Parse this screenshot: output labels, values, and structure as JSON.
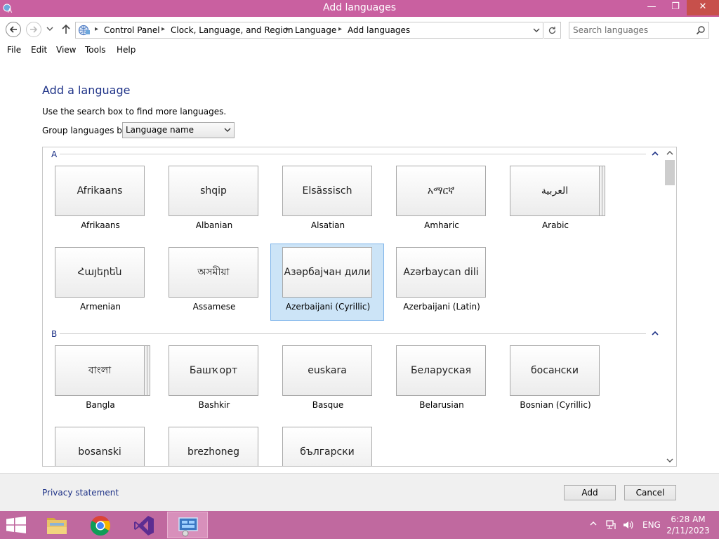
{
  "window": {
    "title": "Add languages",
    "min_label": "—",
    "max_label": "❐",
    "close_label": "✕"
  },
  "address": {
    "breadcrumbs": [
      "Control Panel",
      "Clock, Language, and Region",
      "Language",
      "Add languages"
    ],
    "search_placeholder": "Search languages"
  },
  "menu": [
    "File",
    "Edit",
    "View",
    "Tools",
    "Help"
  ],
  "main": {
    "title": "Add a language",
    "hint": "Use the search box to find more languages.",
    "group_by_label": "Group languages by:",
    "group_by_value": "Language name"
  },
  "groups": [
    {
      "letter": "A",
      "languages": [
        {
          "native": "Afrikaans",
          "name": "Afrikaans"
        },
        {
          "native": "shqip",
          "name": "Albanian"
        },
        {
          "native": "Elsässisch",
          "name": "Alsatian"
        },
        {
          "native": "አማርኛ",
          "name": "Amharic"
        },
        {
          "native": "العربية",
          "name": "Arabic"
        },
        {
          "native": "Հայերեն",
          "name": "Armenian"
        },
        {
          "native": "অসমীয়া",
          "name": "Assamese"
        },
        {
          "native": "Азәрбајҹан дили",
          "name": "Azerbaijani (Cyrillic)"
        },
        {
          "native": "Azərbaycan dili",
          "name": "Azerbaijani (Latin)"
        }
      ]
    },
    {
      "letter": "B",
      "languages": [
        {
          "native": "বাংলা",
          "name": "Bangla"
        },
        {
          "native": "Башҡорт",
          "name": "Bashkir"
        },
        {
          "native": "euskara",
          "name": "Basque"
        },
        {
          "native": "Беларуская",
          "name": "Belarusian"
        },
        {
          "native": "босански",
          "name": "Bosnian (Cyrillic)"
        },
        {
          "native": "bosanski",
          "name": ""
        },
        {
          "native": "brezhoneg",
          "name": ""
        },
        {
          "native": "български",
          "name": ""
        }
      ]
    }
  ],
  "footer": {
    "privacy": "Privacy statement",
    "add_label": "Add",
    "cancel_label": "Cancel"
  },
  "taskbar": {
    "language": "ENG",
    "time": "6:28 AM",
    "date": "2/11/2023"
  },
  "colors": {
    "titlebar": "#c960a0",
    "taskbar": "#c0699f",
    "link": "#1e3287",
    "selection": "#cce4f7"
  }
}
